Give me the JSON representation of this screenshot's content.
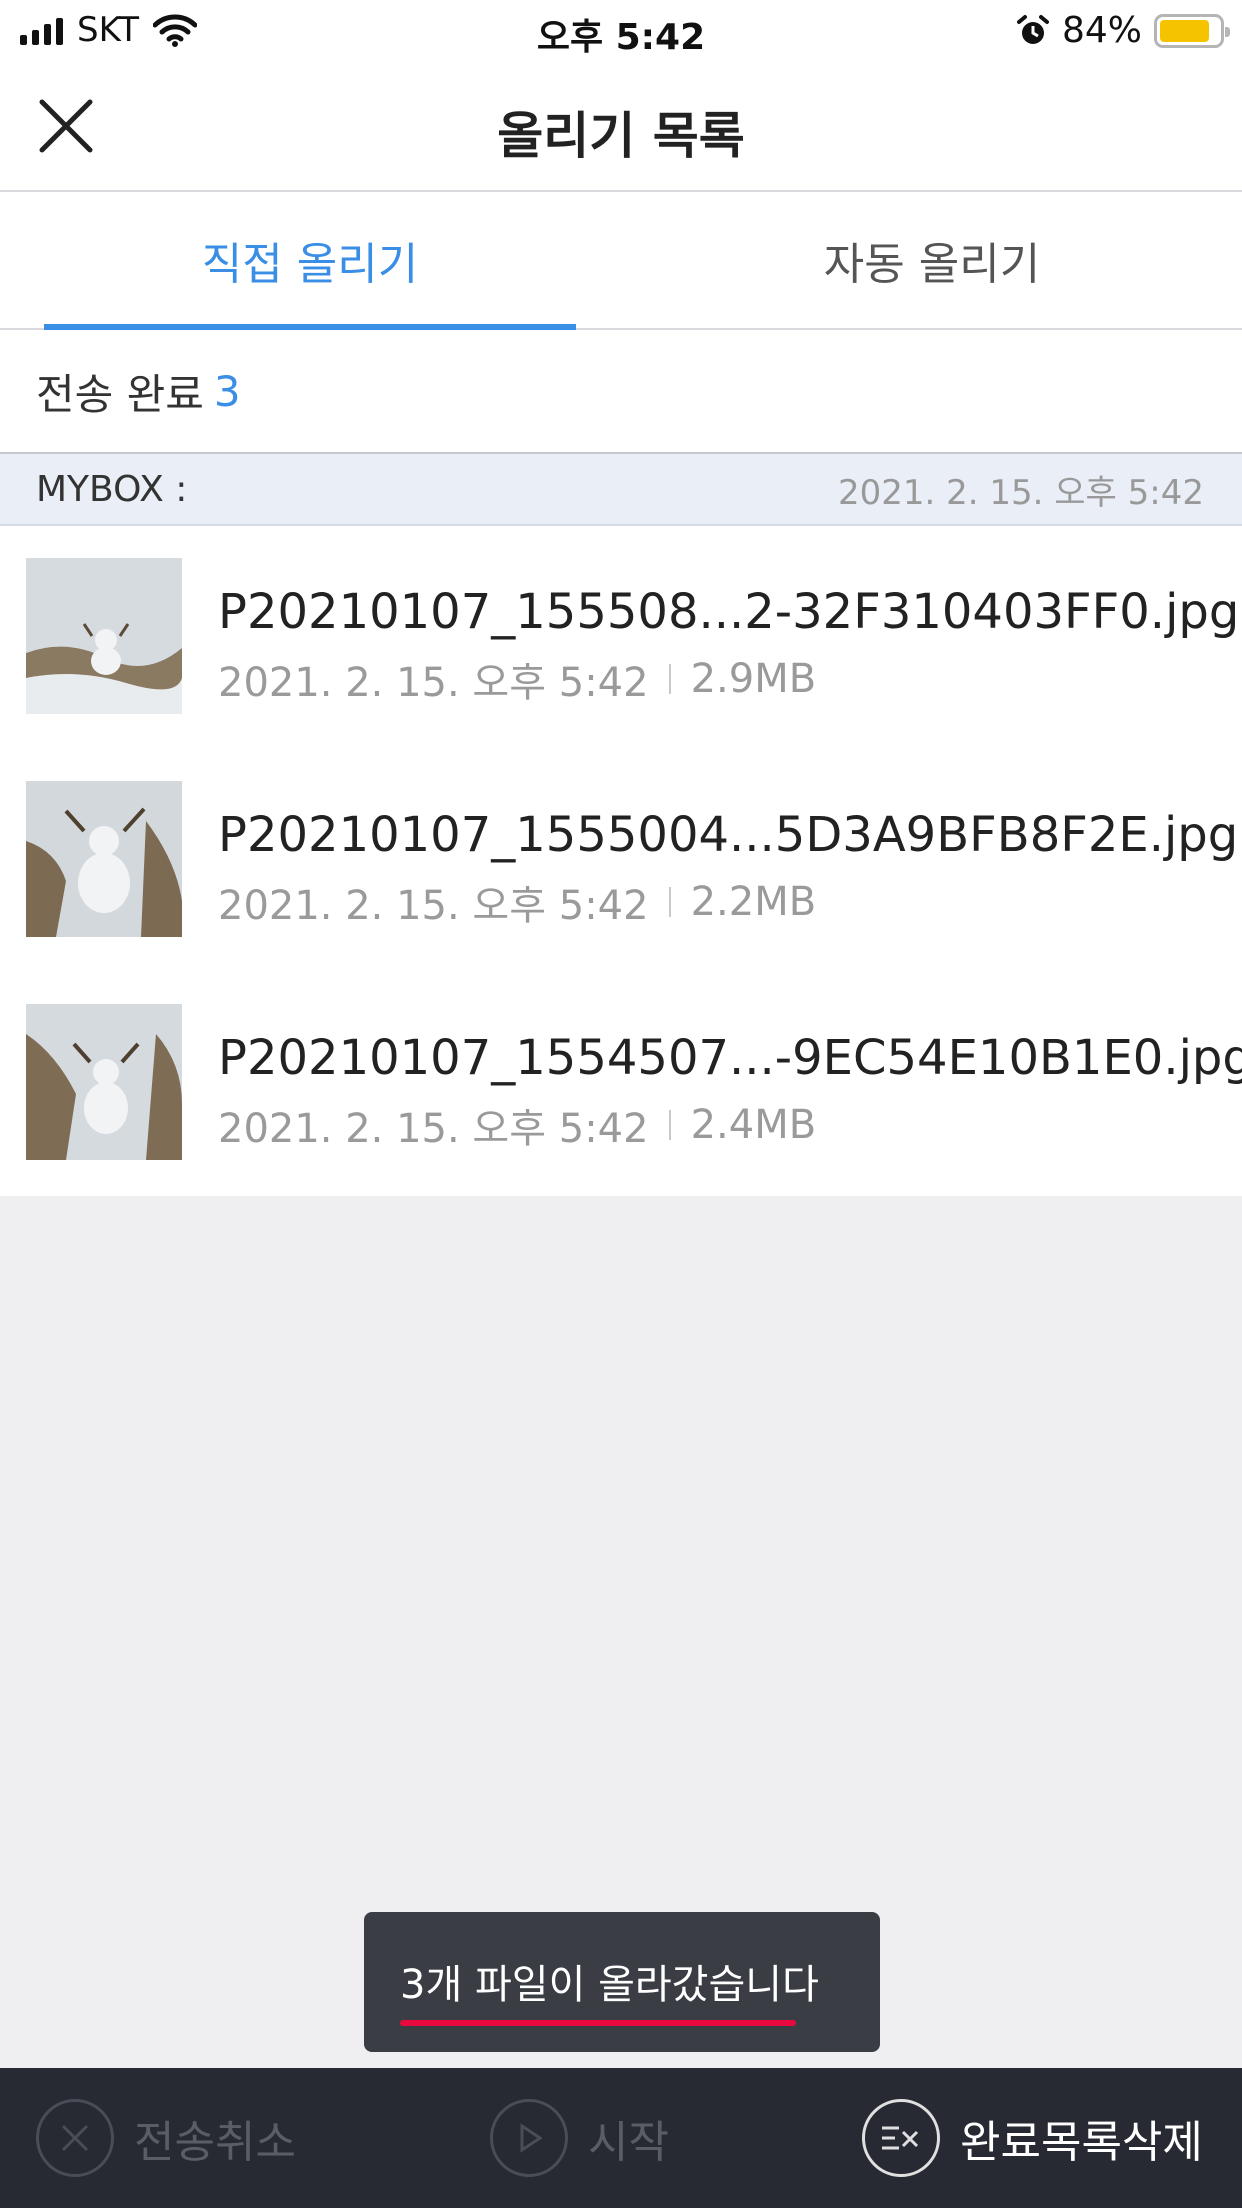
{
  "status_bar": {
    "carrier": "SKT",
    "time": "오후 5:42",
    "battery_text": "84%",
    "battery_level": 0.84,
    "icons": [
      "signal-icon",
      "wifi-icon",
      "alarm-icon",
      "battery-icon"
    ]
  },
  "nav": {
    "title": "올리기 목록",
    "close_icon": "close-icon"
  },
  "tabs": [
    {
      "label": "직접 올리기",
      "active": true
    },
    {
      "label": "자동 올리기",
      "active": false
    }
  ],
  "summary": {
    "label": "전송 완료",
    "count": "3"
  },
  "section": {
    "label": "MYBOX :",
    "date": "2021. 2. 15. 오후 5:42"
  },
  "files": [
    {
      "name": "P20210107_155508...2-32F310403FF0.jpg",
      "date": "2021. 2. 15. 오후 5:42",
      "size": "2.9MB"
    },
    {
      "name": "P20210107_1555004...5D3A9BFB8F2E.jpg",
      "date": "2021. 2. 15. 오후 5:42",
      "size": "2.2MB"
    },
    {
      "name": "P20210107_1554507...-9EC54E10B1E0.jpg",
      "date": "2021. 2. 15. 오후 5:42",
      "size": "2.4MB"
    }
  ],
  "toast": {
    "message": "3개 파일이 올라갔습니다"
  },
  "toolbar": {
    "cancel_label": "전송취소",
    "start_label": "시작",
    "clear_label": "완료목록삭제"
  },
  "colors": {
    "accent": "#3a8ee6",
    "toolbar_bg": "#272a33",
    "toast_underline": "#e8093f",
    "battery": "#f6c300"
  }
}
